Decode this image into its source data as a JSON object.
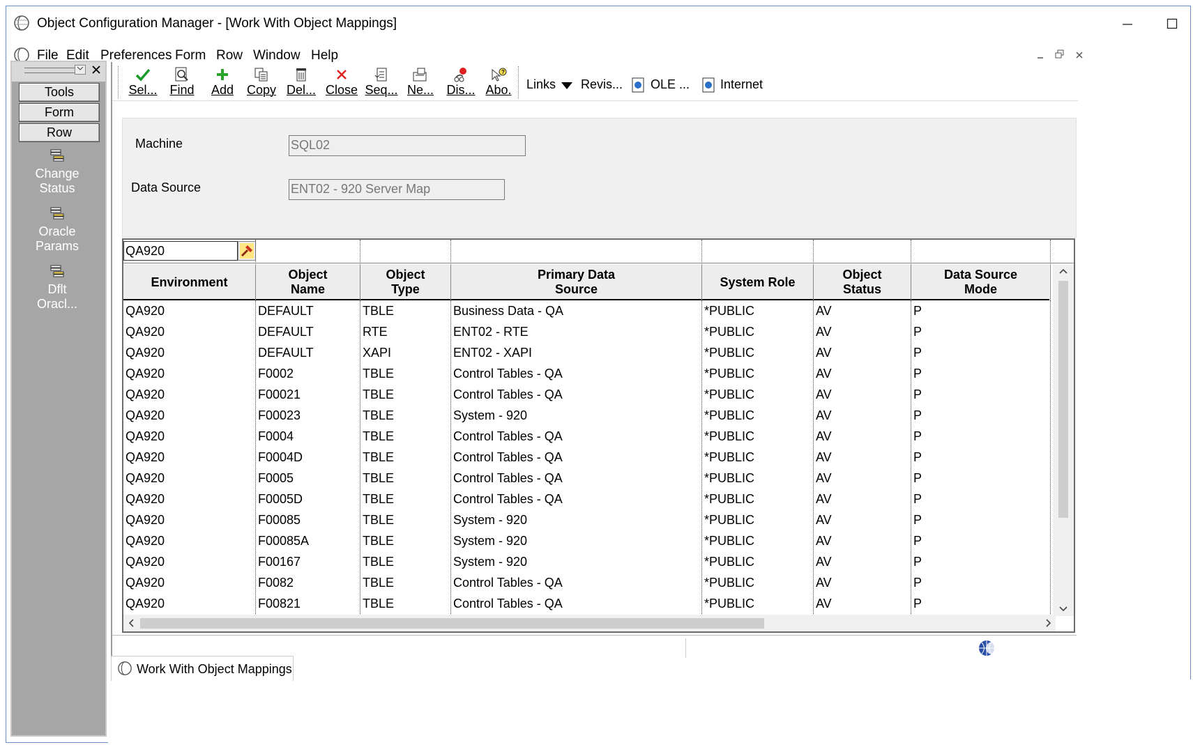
{
  "titlebar": {
    "title": "Object Configuration Manager - [Work With Object Mappings]"
  },
  "menubar": {
    "items": [
      "File",
      "Edit",
      "Preferences",
      "Form",
      "Row",
      "Window",
      "Help"
    ]
  },
  "leftpanel": {
    "tabs": [
      "Tools",
      "Form",
      "Row"
    ],
    "actions": [
      {
        "line1": "Change",
        "line2": "Status"
      },
      {
        "line1": "Oracle",
        "line2": "Params"
      },
      {
        "line1": "Dflt",
        "line2": "Oracl..."
      }
    ]
  },
  "toolbar": {
    "buttons": [
      {
        "label": "Sel...",
        "icon": "checkmark-icon"
      },
      {
        "label": "Find",
        "icon": "find-icon"
      },
      {
        "label": "Add",
        "icon": "plus-icon"
      },
      {
        "label": "Copy",
        "icon": "copy-icon"
      },
      {
        "label": "Del...",
        "icon": "trash-icon"
      },
      {
        "label": "Close",
        "icon": "close-icon"
      },
      {
        "label": "Seq...",
        "icon": "sequence-icon"
      },
      {
        "label": "Ne...",
        "icon": "next-icon"
      },
      {
        "label": "Dis...",
        "icon": "display-icon"
      },
      {
        "label": "Abo.",
        "icon": "about-icon"
      }
    ],
    "links_label": "Links",
    "revis_label": "Revis...",
    "ole_label": "OLE ...",
    "internet_label": "Internet"
  },
  "form": {
    "machine_label": "Machine",
    "machine_value": "SQL02",
    "datasource_label": "Data Source",
    "datasource_value": "ENT02 - 920 Server Map"
  },
  "grid": {
    "qbe_value": "QA920",
    "columns": [
      {
        "line1": "Environment",
        "line2": ""
      },
      {
        "line1": "Object",
        "line2": "Name"
      },
      {
        "line1": "Object",
        "line2": "Type"
      },
      {
        "line1": "Primary Data",
        "line2": "Source"
      },
      {
        "line1": "System Role",
        "line2": ""
      },
      {
        "line1": "Object",
        "line2": "Status"
      },
      {
        "line1": "Data Source",
        "line2": "Mode"
      }
    ],
    "rows": [
      [
        "QA920",
        "DEFAULT",
        "TBLE",
        "Business Data - QA",
        "*PUBLIC",
        "AV",
        "P"
      ],
      [
        "QA920",
        "DEFAULT",
        "RTE",
        "ENT02 - RTE",
        "*PUBLIC",
        "AV",
        "P"
      ],
      [
        "QA920",
        "DEFAULT",
        "XAPI",
        "ENT02 - XAPI",
        "*PUBLIC",
        "AV",
        "P"
      ],
      [
        "QA920",
        "F0002",
        "TBLE",
        "Control Tables - QA",
        "*PUBLIC",
        "AV",
        "P"
      ],
      [
        "QA920",
        "F00021",
        "TBLE",
        "Control Tables - QA",
        "*PUBLIC",
        "AV",
        "P"
      ],
      [
        "QA920",
        "F00023",
        "TBLE",
        "System - 920",
        "*PUBLIC",
        "AV",
        "P"
      ],
      [
        "QA920",
        "F0004",
        "TBLE",
        "Control Tables - QA",
        "*PUBLIC",
        "AV",
        "P"
      ],
      [
        "QA920",
        "F0004D",
        "TBLE",
        "Control Tables - QA",
        "*PUBLIC",
        "AV",
        "P"
      ],
      [
        "QA920",
        "F0005",
        "TBLE",
        "Control Tables - QA",
        "*PUBLIC",
        "AV",
        "P"
      ],
      [
        "QA920",
        "F0005D",
        "TBLE",
        "Control Tables - QA",
        "*PUBLIC",
        "AV",
        "P"
      ],
      [
        "QA920",
        "F00085",
        "TBLE",
        "System - 920",
        "*PUBLIC",
        "AV",
        "P"
      ],
      [
        "QA920",
        "F00085A",
        "TBLE",
        "System - 920",
        "*PUBLIC",
        "AV",
        "P"
      ],
      [
        "QA920",
        "F00167",
        "TBLE",
        "System - 920",
        "*PUBLIC",
        "AV",
        "P"
      ],
      [
        "QA920",
        "F0082",
        "TBLE",
        "Control Tables - QA",
        "*PUBLIC",
        "AV",
        "P"
      ],
      [
        "QA920",
        "F00821",
        "TBLE",
        "Control Tables - QA",
        "*PUBLIC",
        "AV",
        "P"
      ]
    ]
  },
  "bottomtab": {
    "label": "Work With Object Mappings"
  },
  "colors": {
    "left_panel_bg": "#a6a6a6",
    "check_green": "#1a9a2a",
    "add_green": "#2aa52a",
    "close_red": "#e02020",
    "window_border": "#6d8fc8"
  }
}
